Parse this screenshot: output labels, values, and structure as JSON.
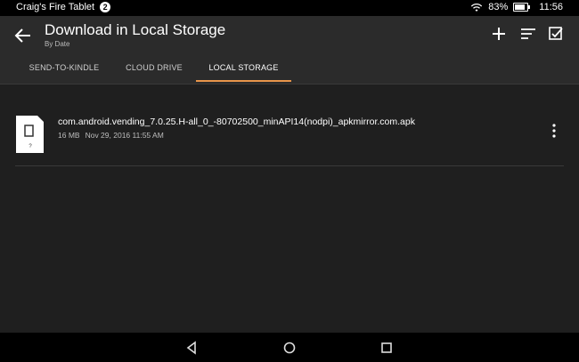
{
  "status_bar": {
    "device_name": "Craig's Fire Tablet",
    "notification_count": "2",
    "battery_percent": "83%",
    "battery_level": 0.83,
    "time": "11:56",
    "icons": [
      "wifi-icon",
      "battery-icon"
    ]
  },
  "header": {
    "title": "Download in Local Storage",
    "subtitle": "By Date",
    "icons": [
      "back-arrow-icon",
      "add-icon",
      "sort-icon",
      "select-checkbox-icon"
    ]
  },
  "tabs": [
    {
      "label": "SEND-TO-KINDLE",
      "active": false
    },
    {
      "label": "CLOUD DRIVE",
      "active": false
    },
    {
      "label": "LOCAL STORAGE",
      "active": true
    }
  ],
  "accent_color": "#e8954a",
  "files": [
    {
      "name": "com.android.vending_7.0.25.H-all_0_-80702500_minAPI14(nodpi)_apkmirror.com.apk",
      "size": "16 MB",
      "date": "Nov 29, 2016 11:55 AM",
      "icon": "unknown-file-icon",
      "icon_label": "?"
    }
  ],
  "nav_bar": {
    "icons": [
      "back-icon",
      "home-icon",
      "recents-icon"
    ]
  }
}
